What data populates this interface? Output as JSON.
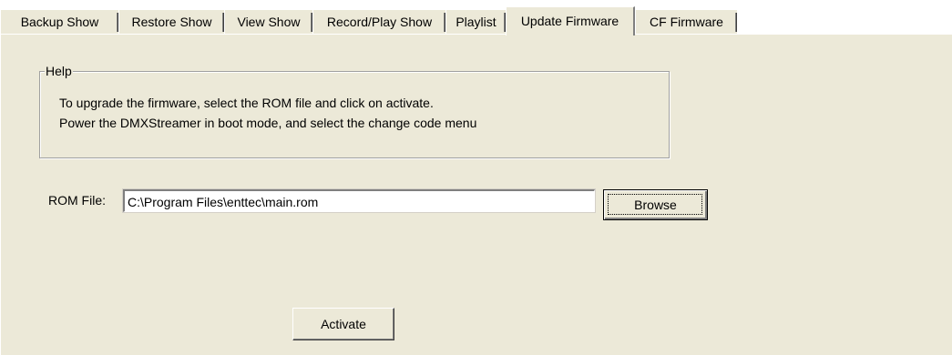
{
  "tabs": [
    {
      "label": "Backup Show",
      "active": false
    },
    {
      "label": "Restore Show",
      "active": false
    },
    {
      "label": "View Show",
      "active": false
    },
    {
      "label": "Record/Play Show",
      "active": false
    },
    {
      "label": "Playlist",
      "active": false
    },
    {
      "label": "Update Firmware",
      "active": true
    },
    {
      "label": "CF Firmware",
      "active": false
    }
  ],
  "help": {
    "title": "Help",
    "lines": [
      "To upgrade the firmware, select the ROM file and click on activate.",
      "Power the DMXStreamer in boot mode, and select the change code menu"
    ]
  },
  "rom_file": {
    "label": "ROM File:",
    "value": "C:\\Program Files\\enttec\\main.rom"
  },
  "buttons": {
    "browse": "Browse",
    "activate": "Activate"
  },
  "colors": {
    "face": "#ece9d8",
    "highlight": "#ffffff",
    "shadow": "#808080"
  }
}
